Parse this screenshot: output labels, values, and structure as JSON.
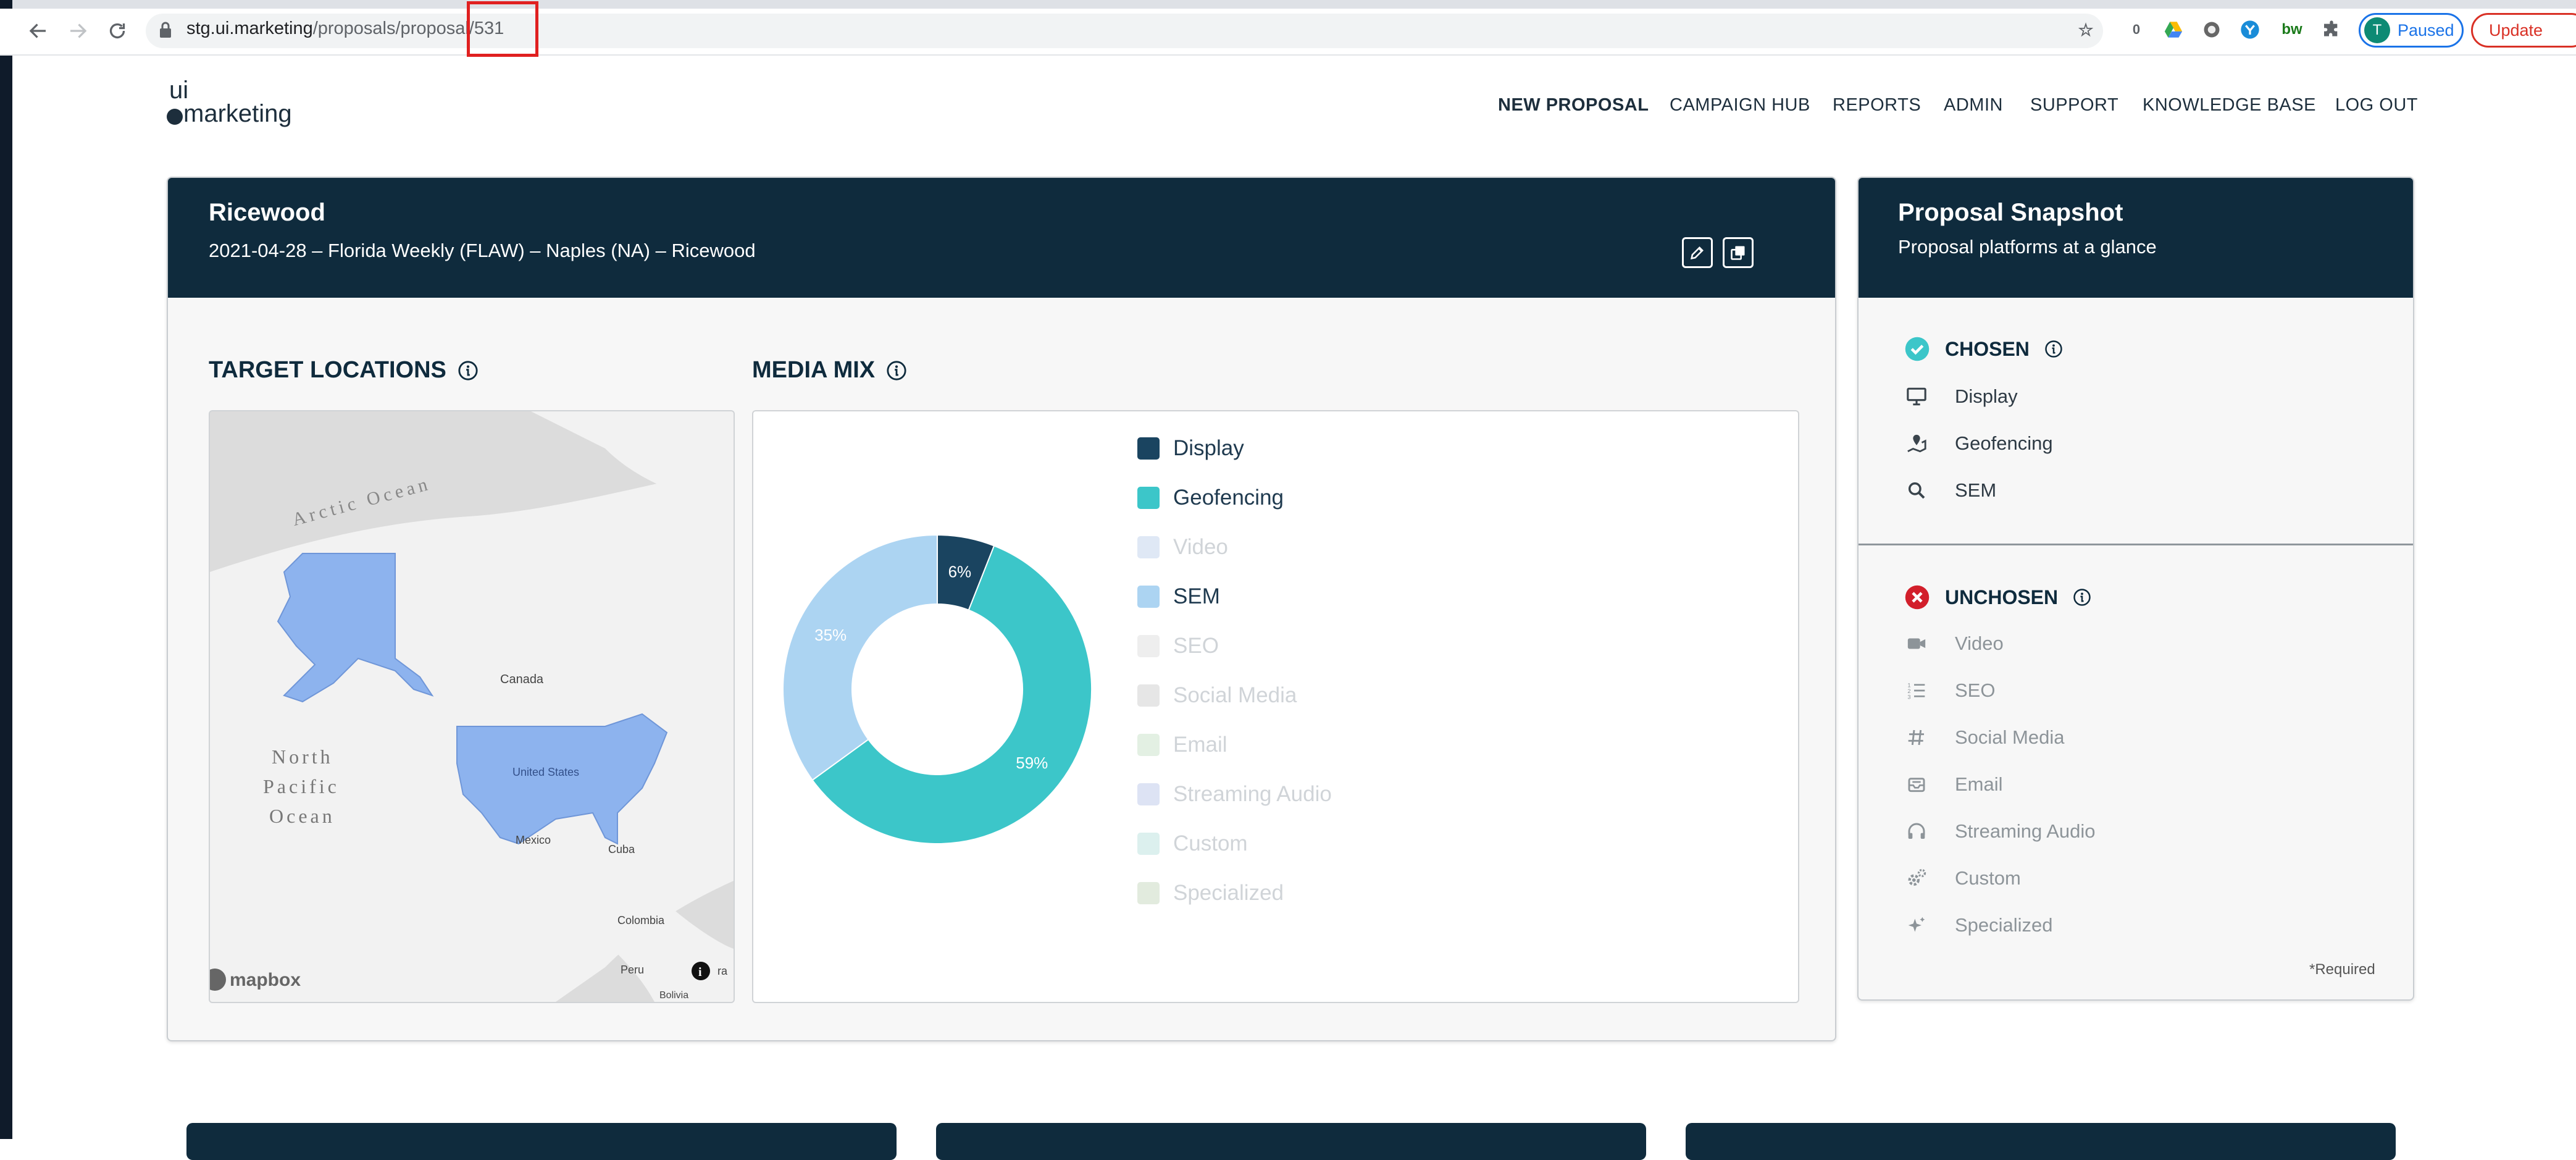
{
  "browser": {
    "url_host": "stg.ui.marketing",
    "url_path": "/proposals/proposal/531",
    "profile_initial": "T",
    "profile_status": "Paused",
    "update_label": "Update",
    "extension_badge": "0"
  },
  "header": {
    "logo_top": "ui",
    "logo_bottom": "marketing",
    "nav": [
      {
        "label": "NEW PROPOSAL",
        "active": true
      },
      {
        "label": "CAMPAIGN HUB"
      },
      {
        "label": "REPORTS"
      },
      {
        "label": "ADMIN"
      },
      {
        "label": "SUPPORT"
      },
      {
        "label": "KNOWLEDGE BASE"
      },
      {
        "label": "LOG OUT"
      }
    ]
  },
  "proposal": {
    "title": "Ricewood",
    "subtitle": "2021-04-28 – Florida Weekly (FLAW) – Naples (NA) – Ricewood"
  },
  "target_locations": {
    "title": "TARGET LOCATIONS",
    "map_labels": {
      "arctic": "Arctic Ocean",
      "canada": "Canada",
      "us": "United States",
      "mexico": "Mexico",
      "cuba": "Cuba",
      "colombia": "Colombia",
      "peru": "Peru",
      "bolivia": "Bolivia",
      "pacific_1": "North",
      "pacific_2": "Pacific",
      "pacific_3": "Ocean",
      "ra": "ra"
    },
    "attribution": "mapbox"
  },
  "media_mix": {
    "title": "MEDIA MIX",
    "legend": [
      {
        "label": "Display",
        "color": "#1a4460",
        "active": true
      },
      {
        "label": "Geofencing",
        "color": "#3cc6c9",
        "active": true
      },
      {
        "label": "Video",
        "color": "#dfe8f5",
        "active": false
      },
      {
        "label": "SEM",
        "color": "#acd4f2",
        "active": true
      },
      {
        "label": "SEO",
        "color": "#eeeeee",
        "active": false
      },
      {
        "label": "Social Media",
        "color": "#e6e6e6",
        "active": false
      },
      {
        "label": "Email",
        "color": "#e3f0e3",
        "active": false
      },
      {
        "label": "Streaming Audio",
        "color": "#dde3f4",
        "active": false
      },
      {
        "label": "Custom",
        "color": "#dcf0ee",
        "active": false
      },
      {
        "label": "Specialized",
        "color": "#e2ebde",
        "active": false
      }
    ]
  },
  "chart_data": {
    "type": "pie",
    "categories": [
      "Display",
      "Geofencing",
      "SEM"
    ],
    "values": [
      6,
      59,
      35
    ],
    "labels": [
      "6%",
      "59%",
      "35%"
    ],
    "colors": [
      "#1a4460",
      "#3cc6c9",
      "#acd4f2"
    ],
    "legend_placement": "right"
  },
  "snapshot": {
    "title": "Proposal Snapshot",
    "subtitle": "Proposal platforms at a glance",
    "chosen_heading": "CHOSEN",
    "chosen": [
      {
        "label": "Display",
        "icon": "monitor-icon"
      },
      {
        "label": "Geofencing",
        "icon": "map-pin-icon"
      },
      {
        "label": "SEM",
        "icon": "search-icon"
      }
    ],
    "unchosen_heading": "UNCHOSEN",
    "unchosen": [
      {
        "label": "Video",
        "icon": "video-icon"
      },
      {
        "label": "SEO",
        "icon": "list-icon"
      },
      {
        "label": "Social Media",
        "icon": "hashtag-icon"
      },
      {
        "label": "Email",
        "icon": "inbox-icon"
      },
      {
        "label": "Streaming Audio",
        "icon": "headphones-icon"
      },
      {
        "label": "Custom",
        "icon": "gears-icon"
      },
      {
        "label": "Specialized",
        "icon": "sparkle-icon"
      }
    ],
    "required_note": "*Required"
  }
}
